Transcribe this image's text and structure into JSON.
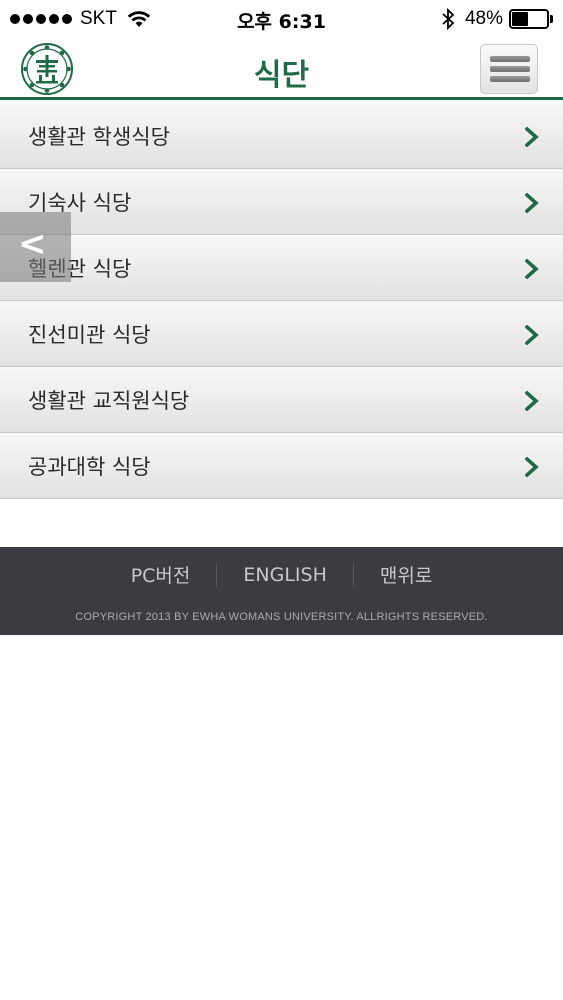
{
  "status_bar": {
    "carrier": "SKT",
    "time": "오후 6:31",
    "battery_percent": "48%",
    "battery_level": 0.48
  },
  "header": {
    "title": "식단",
    "logo_icon": "ewha-emblem-icon",
    "menu_icon": "hamburger-menu-icon"
  },
  "menu": {
    "items": [
      {
        "label": "생활관 학생식당"
      },
      {
        "label": "기숙사 식당"
      },
      {
        "label": "헬렌관 식당"
      },
      {
        "label": "진선미관 식당"
      },
      {
        "label": "생활관 교직원식당"
      },
      {
        "label": "공과대학 식당"
      }
    ]
  },
  "back_overlay": {
    "glyph": "<"
  },
  "footer": {
    "links": [
      "PC버전",
      "ENGLISH",
      "맨위로"
    ],
    "copyright": "COPYRIGHT 2013 BY EWHA WOMANS UNIVERSITY. ALLRIGHTS RESERVED."
  },
  "colors": {
    "brand_green": "#1f6b47",
    "footer_bg": "#3a3c42"
  }
}
